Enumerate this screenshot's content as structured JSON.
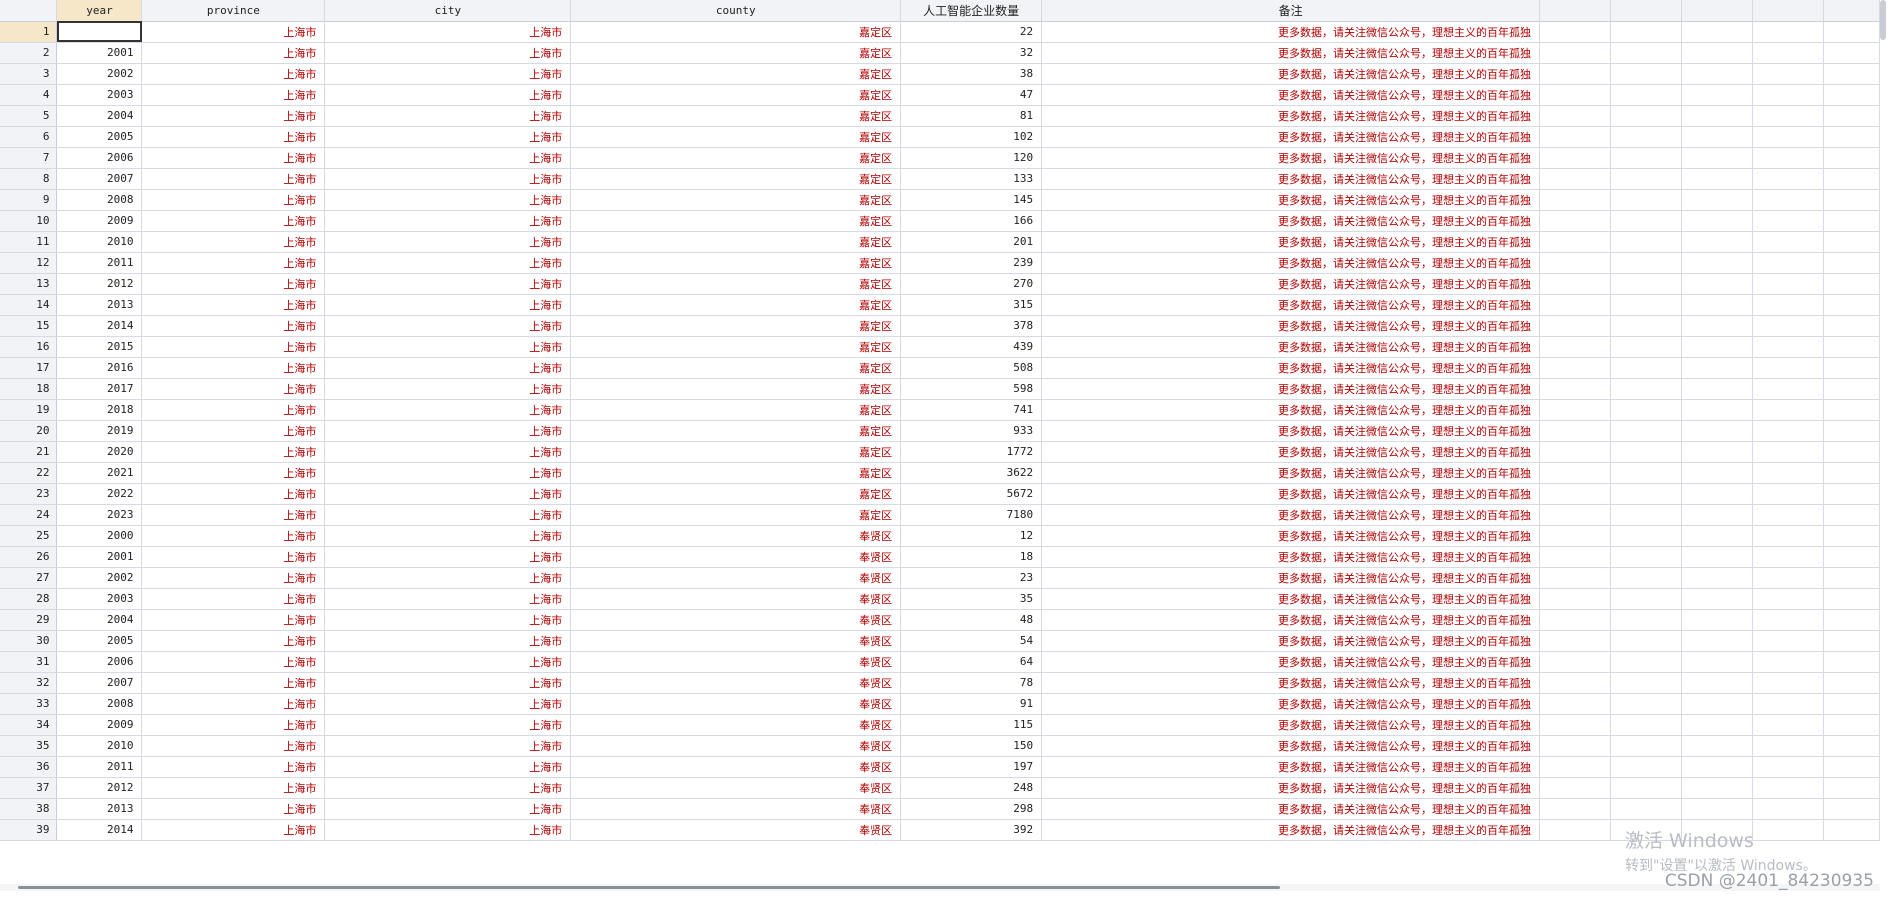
{
  "columns": [
    "year",
    "province",
    "city",
    "county",
    "人工智能企业数量",
    "备注"
  ],
  "rows": [
    {
      "n": "1",
      "year": "",
      "province": "上海市",
      "city": "上海市",
      "county": "嘉定区",
      "count": "22",
      "note": "更多数据，请关注微信公众号，理想主义的百年孤独"
    },
    {
      "n": "2",
      "year": "2001",
      "province": "上海市",
      "city": "上海市",
      "county": "嘉定区",
      "count": "32",
      "note": "更多数据，请关注微信公众号，理想主义的百年孤独"
    },
    {
      "n": "3",
      "year": "2002",
      "province": "上海市",
      "city": "上海市",
      "county": "嘉定区",
      "count": "38",
      "note": "更多数据，请关注微信公众号，理想主义的百年孤独"
    },
    {
      "n": "4",
      "year": "2003",
      "province": "上海市",
      "city": "上海市",
      "county": "嘉定区",
      "count": "47",
      "note": "更多数据，请关注微信公众号，理想主义的百年孤独"
    },
    {
      "n": "5",
      "year": "2004",
      "province": "上海市",
      "city": "上海市",
      "county": "嘉定区",
      "count": "81",
      "note": "更多数据，请关注微信公众号，理想主义的百年孤独"
    },
    {
      "n": "6",
      "year": "2005",
      "province": "上海市",
      "city": "上海市",
      "county": "嘉定区",
      "count": "102",
      "note": "更多数据，请关注微信公众号，理想主义的百年孤独"
    },
    {
      "n": "7",
      "year": "2006",
      "province": "上海市",
      "city": "上海市",
      "county": "嘉定区",
      "count": "120",
      "note": "更多数据，请关注微信公众号，理想主义的百年孤独"
    },
    {
      "n": "8",
      "year": "2007",
      "province": "上海市",
      "city": "上海市",
      "county": "嘉定区",
      "count": "133",
      "note": "更多数据，请关注微信公众号，理想主义的百年孤独"
    },
    {
      "n": "9",
      "year": "2008",
      "province": "上海市",
      "city": "上海市",
      "county": "嘉定区",
      "count": "145",
      "note": "更多数据，请关注微信公众号，理想主义的百年孤独"
    },
    {
      "n": "10",
      "year": "2009",
      "province": "上海市",
      "city": "上海市",
      "county": "嘉定区",
      "count": "166",
      "note": "更多数据，请关注微信公众号，理想主义的百年孤独"
    },
    {
      "n": "11",
      "year": "2010",
      "province": "上海市",
      "city": "上海市",
      "county": "嘉定区",
      "count": "201",
      "note": "更多数据，请关注微信公众号，理想主义的百年孤独"
    },
    {
      "n": "12",
      "year": "2011",
      "province": "上海市",
      "city": "上海市",
      "county": "嘉定区",
      "count": "239",
      "note": "更多数据，请关注微信公众号，理想主义的百年孤独"
    },
    {
      "n": "13",
      "year": "2012",
      "province": "上海市",
      "city": "上海市",
      "county": "嘉定区",
      "count": "270",
      "note": "更多数据，请关注微信公众号，理想主义的百年孤独"
    },
    {
      "n": "14",
      "year": "2013",
      "province": "上海市",
      "city": "上海市",
      "county": "嘉定区",
      "count": "315",
      "note": "更多数据，请关注微信公众号，理想主义的百年孤独"
    },
    {
      "n": "15",
      "year": "2014",
      "province": "上海市",
      "city": "上海市",
      "county": "嘉定区",
      "count": "378",
      "note": "更多数据，请关注微信公众号，理想主义的百年孤独"
    },
    {
      "n": "16",
      "year": "2015",
      "province": "上海市",
      "city": "上海市",
      "county": "嘉定区",
      "count": "439",
      "note": "更多数据，请关注微信公众号，理想主义的百年孤独"
    },
    {
      "n": "17",
      "year": "2016",
      "province": "上海市",
      "city": "上海市",
      "county": "嘉定区",
      "count": "508",
      "note": "更多数据，请关注微信公众号，理想主义的百年孤独"
    },
    {
      "n": "18",
      "year": "2017",
      "province": "上海市",
      "city": "上海市",
      "county": "嘉定区",
      "count": "598",
      "note": "更多数据，请关注微信公众号，理想主义的百年孤独"
    },
    {
      "n": "19",
      "year": "2018",
      "province": "上海市",
      "city": "上海市",
      "county": "嘉定区",
      "count": "741",
      "note": "更多数据，请关注微信公众号，理想主义的百年孤独"
    },
    {
      "n": "20",
      "year": "2019",
      "province": "上海市",
      "city": "上海市",
      "county": "嘉定区",
      "count": "933",
      "note": "更多数据，请关注微信公众号，理想主义的百年孤独"
    },
    {
      "n": "21",
      "year": "2020",
      "province": "上海市",
      "city": "上海市",
      "county": "嘉定区",
      "count": "1772",
      "note": "更多数据，请关注微信公众号，理想主义的百年孤独"
    },
    {
      "n": "22",
      "year": "2021",
      "province": "上海市",
      "city": "上海市",
      "county": "嘉定区",
      "count": "3622",
      "note": "更多数据，请关注微信公众号，理想主义的百年孤独"
    },
    {
      "n": "23",
      "year": "2022",
      "province": "上海市",
      "city": "上海市",
      "county": "嘉定区",
      "count": "5672",
      "note": "更多数据，请关注微信公众号，理想主义的百年孤独"
    },
    {
      "n": "24",
      "year": "2023",
      "province": "上海市",
      "city": "上海市",
      "county": "嘉定区",
      "count": "7180",
      "note": "更多数据，请关注微信公众号，理想主义的百年孤独"
    },
    {
      "n": "25",
      "year": "2000",
      "province": "上海市",
      "city": "上海市",
      "county": "奉贤区",
      "count": "12",
      "note": "更多数据，请关注微信公众号，理想主义的百年孤独"
    },
    {
      "n": "26",
      "year": "2001",
      "province": "上海市",
      "city": "上海市",
      "county": "奉贤区",
      "count": "18",
      "note": "更多数据，请关注微信公众号，理想主义的百年孤独"
    },
    {
      "n": "27",
      "year": "2002",
      "province": "上海市",
      "city": "上海市",
      "county": "奉贤区",
      "count": "23",
      "note": "更多数据，请关注微信公众号，理想主义的百年孤独"
    },
    {
      "n": "28",
      "year": "2003",
      "province": "上海市",
      "city": "上海市",
      "county": "奉贤区",
      "count": "35",
      "note": "更多数据，请关注微信公众号，理想主义的百年孤独"
    },
    {
      "n": "29",
      "year": "2004",
      "province": "上海市",
      "city": "上海市",
      "county": "奉贤区",
      "count": "48",
      "note": "更多数据，请关注微信公众号，理想主义的百年孤独"
    },
    {
      "n": "30",
      "year": "2005",
      "province": "上海市",
      "city": "上海市",
      "county": "奉贤区",
      "count": "54",
      "note": "更多数据，请关注微信公众号，理想主义的百年孤独"
    },
    {
      "n": "31",
      "year": "2006",
      "province": "上海市",
      "city": "上海市",
      "county": "奉贤区",
      "count": "64",
      "note": "更多数据，请关注微信公众号，理想主义的百年孤独"
    },
    {
      "n": "32",
      "year": "2007",
      "province": "上海市",
      "city": "上海市",
      "county": "奉贤区",
      "count": "78",
      "note": "更多数据，请关注微信公众号，理想主义的百年孤独"
    },
    {
      "n": "33",
      "year": "2008",
      "province": "上海市",
      "city": "上海市",
      "county": "奉贤区",
      "count": "91",
      "note": "更多数据，请关注微信公众号，理想主义的百年孤独"
    },
    {
      "n": "34",
      "year": "2009",
      "province": "上海市",
      "city": "上海市",
      "county": "奉贤区",
      "count": "115",
      "note": "更多数据，请关注微信公众号，理想主义的百年孤独"
    },
    {
      "n": "35",
      "year": "2010",
      "province": "上海市",
      "city": "上海市",
      "county": "奉贤区",
      "count": "150",
      "note": "更多数据，请关注微信公众号，理想主义的百年孤独"
    },
    {
      "n": "36",
      "year": "2011",
      "province": "上海市",
      "city": "上海市",
      "county": "奉贤区",
      "count": "197",
      "note": "更多数据，请关注微信公众号，理想主义的百年孤独"
    },
    {
      "n": "37",
      "year": "2012",
      "province": "上海市",
      "city": "上海市",
      "county": "奉贤区",
      "count": "248",
      "note": "更多数据，请关注微信公众号，理想主义的百年孤独"
    },
    {
      "n": "38",
      "year": "2013",
      "province": "上海市",
      "city": "上海市",
      "county": "奉贤区",
      "count": "298",
      "note": "更多数据，请关注微信公众号，理想主义的百年孤独"
    },
    {
      "n": "39",
      "year": "2014",
      "province": "上海市",
      "city": "上海市",
      "county": "奉贤区",
      "count": "392",
      "note": "更多数据，请关注微信公众号，理想主义的百年孤独"
    }
  ],
  "watermark": {
    "line1": "激活 Windows",
    "line2": "转到\"设置\"以激活 Windows。"
  },
  "credit": "CSDN @2401_84230935",
  "colors": {
    "string_text": "#b30000",
    "selected_header": "#f6e7c8",
    "header_bg": "#f1f3f6"
  }
}
